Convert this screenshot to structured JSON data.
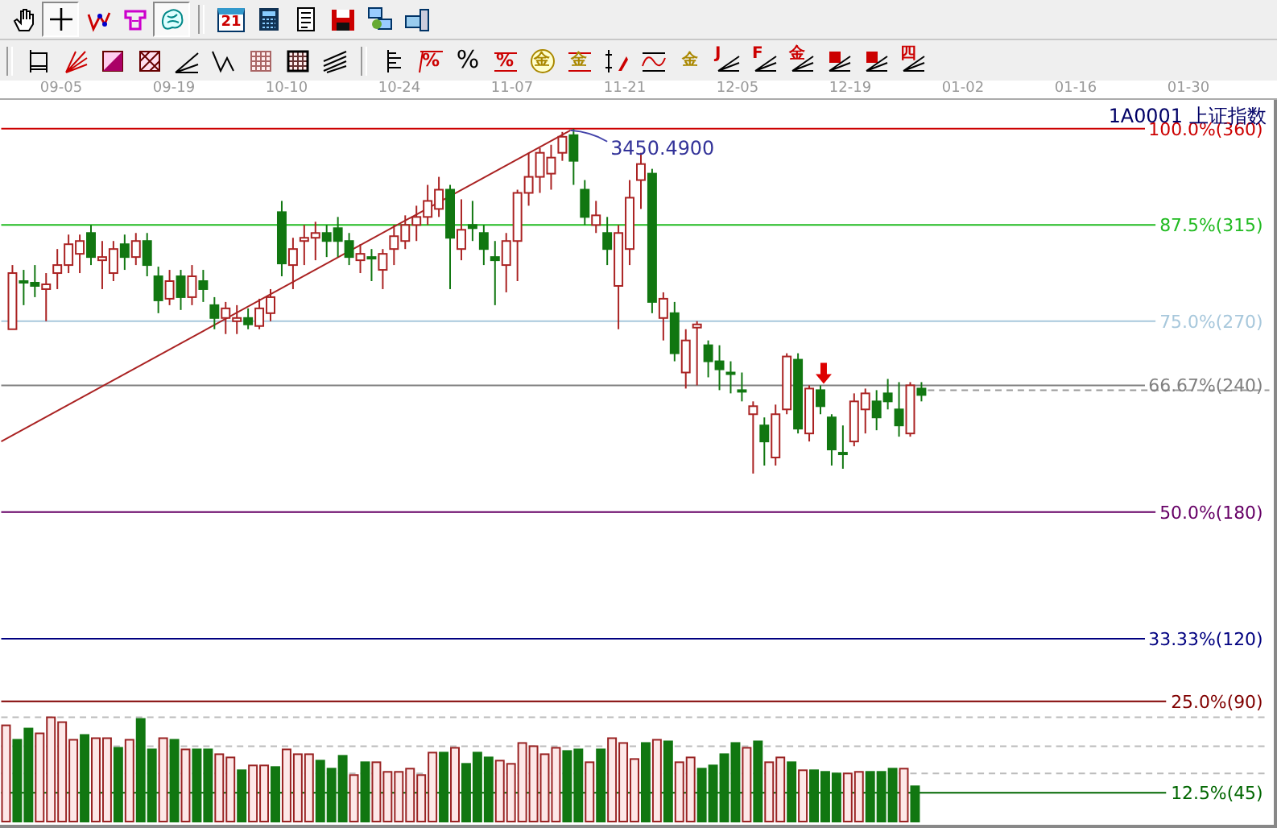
{
  "toolbars": [
    {
      "groups": [
        [
          {
            "kind": "hand",
            "selected": false
          },
          {
            "kind": "crosshair",
            "selected": true
          },
          {
            "kind": "polyline",
            "selected": false
          },
          {
            "kind": "figure",
            "selected": false
          },
          {
            "kind": "brain",
            "selected": true
          }
        ],
        [
          {
            "kind": "calendar",
            "glyph": "21",
            "selected": false
          },
          {
            "kind": "calculator",
            "selected": false
          },
          {
            "kind": "notepad",
            "selected": false
          },
          {
            "kind": "floppy",
            "selected": false
          },
          {
            "kind": "network",
            "selected": false
          },
          {
            "kind": "computer",
            "selected": false
          }
        ]
      ]
    },
    {
      "groups": [
        [
          {
            "kind": "frame",
            "selected": false
          },
          {
            "kind": "fan",
            "selected": false
          },
          {
            "kind": "gradient-square",
            "selected": false
          },
          {
            "kind": "cross-square",
            "selected": false
          },
          {
            "kind": "angle",
            "selected": false
          },
          {
            "kind": "zigzag",
            "selected": false
          },
          {
            "kind": "grid",
            "selected": false
          },
          {
            "kind": "grid-dark",
            "selected": false
          },
          {
            "kind": "parallel",
            "selected": false
          }
        ],
        [
          {
            "kind": "ruler",
            "selected": false
          },
          {
            "kind": "slash-percent",
            "glyph": "%",
            "selected": false
          },
          {
            "kind": "percent",
            "glyph": "%",
            "selected": false
          },
          {
            "kind": "percent-lines",
            "glyph": "%",
            "selected": false
          },
          {
            "kind": "coin",
            "glyph": "金",
            "selected": false
          },
          {
            "kind": "coin-lines",
            "glyph": "金",
            "selected": false
          },
          {
            "kind": "pen",
            "selected": false
          },
          {
            "kind": "wave",
            "selected": false
          },
          {
            "kind": "coin-plain",
            "glyph": "金",
            "selected": false
          },
          {
            "kind": "fan-letter",
            "glyph": "J",
            "selected": false
          },
          {
            "kind": "fan-letter",
            "glyph": "F",
            "selected": false
          },
          {
            "kind": "fan-letter",
            "glyph": "金",
            "selected": false
          },
          {
            "kind": "fan-block",
            "selected": false
          },
          {
            "kind": "fan-block",
            "selected": false
          },
          {
            "kind": "fan-letter",
            "glyph": "四",
            "selected": false
          }
        ]
      ]
    }
  ],
  "date_axis": [
    "09-05",
    "09-19",
    "10-10",
    "10-24",
    "11-07",
    "11-21",
    "12-05",
    "12-19",
    "01-02",
    "01-16",
    "01-30"
  ],
  "chart": {
    "title": "1A0001 上证指数",
    "peak_label": "3450.4900",
    "levels": [
      {
        "label": "100.0%(360)",
        "color": "#cc0000"
      },
      {
        "label": "87.5%(315)",
        "color": "#22bb22"
      },
      {
        "label": "75.0%(270)",
        "color": "#a8c8dc"
      },
      {
        "label": "66.67%(240)",
        "color": "#808080"
      },
      {
        "label": "50.0%(180)",
        "color": "#660066"
      },
      {
        "label": "33.33%(120)",
        "color": "#000080"
      },
      {
        "label": "25.0%(90)",
        "color": "#800000"
      },
      {
        "label": "12.5%(45)",
        "color": "#006600"
      }
    ]
  }
}
